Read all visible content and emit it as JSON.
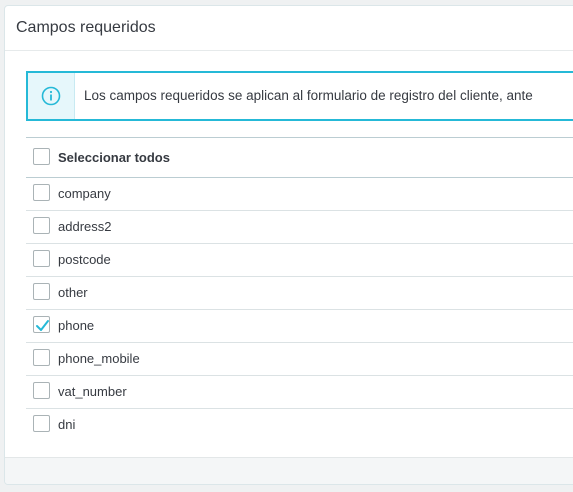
{
  "panel": {
    "title": "Campos requeridos"
  },
  "alert": {
    "icon": "info-icon",
    "text": "Los campos requeridos se aplican al formulario de registro del cliente, ante"
  },
  "fields": {
    "select_all_label": "Seleccionar todos",
    "select_all_checked": false,
    "items": [
      {
        "label": "company",
        "checked": false
      },
      {
        "label": "address2",
        "checked": false
      },
      {
        "label": "postcode",
        "checked": false
      },
      {
        "label": "other",
        "checked": false
      },
      {
        "label": "phone",
        "checked": true
      },
      {
        "label": "phone_mobile",
        "checked": false
      },
      {
        "label": "vat_number",
        "checked": false
      },
      {
        "label": "dni",
        "checked": false
      }
    ]
  },
  "colors": {
    "accent": "#25b9d7",
    "text": "#363a41"
  }
}
